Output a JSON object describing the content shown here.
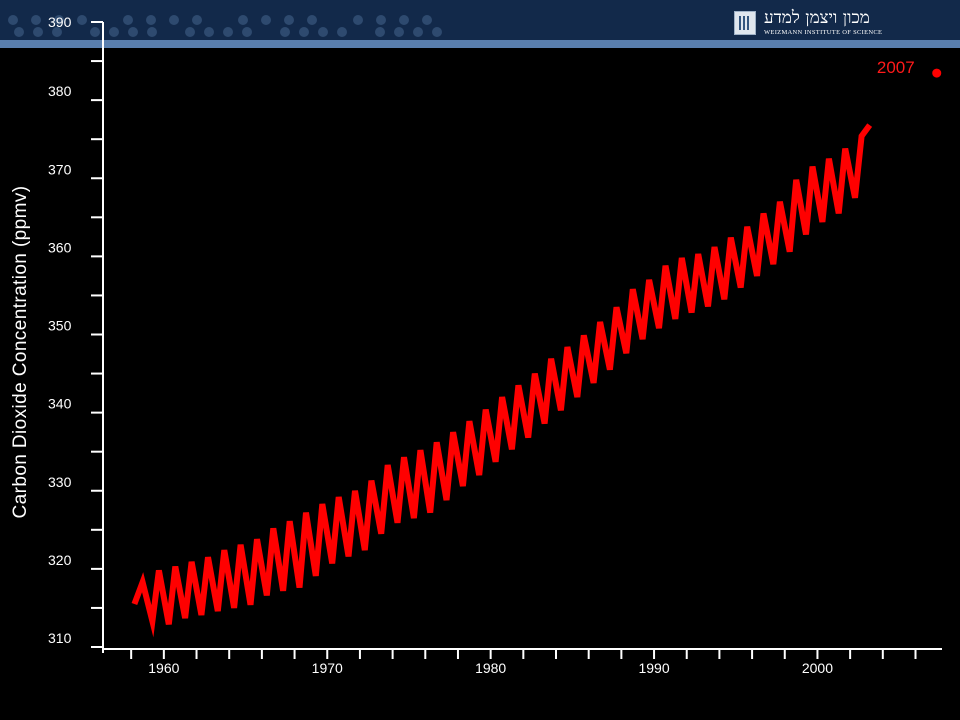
{
  "header": {
    "logo_hebrew": "מכון ויצמן למדע",
    "logo_english": "WEIZMANN INSTITUTE OF SCIENCE",
    "background_color": "#12294a",
    "stripe_color": "#5a7fae"
  },
  "chart_data": {
    "type": "line",
    "title": "",
    "xlabel": "",
    "ylabel": "Carbon Dioxide Concentration (ppmv)",
    "xlim": [
      1957.5,
      2007.5
    ],
    "ylim": [
      310,
      390
    ],
    "x_tick_values": [
      1960,
      1970,
      1980,
      1990,
      2000
    ],
    "x_tick_labels": [
      "1960",
      "1970",
      "1980",
      "1990",
      "2000"
    ],
    "y_tick_values": [
      310,
      320,
      330,
      340,
      350,
      360,
      370,
      380,
      390
    ],
    "y_tick_labels": [
      "310",
      "320",
      "330",
      "340",
      "350",
      "360",
      "370",
      "380",
      "390"
    ],
    "grid": false,
    "line_color": "#ff0000",
    "series": [
      {
        "x": [
          1958.2,
          1958.7,
          1959.3,
          1959.7,
          1960.3,
          1960.7,
          1961.3,
          1961.7,
          1962.3,
          1962.7,
          1963.3,
          1963.7,
          1964.3,
          1964.7,
          1965.3,
          1965.7,
          1966.3,
          1966.7,
          1967.3,
          1967.7,
          1968.3,
          1968.7,
          1969.3,
          1969.7,
          1970.3,
          1970.7,
          1971.3,
          1971.7,
          1972.3,
          1972.7,
          1973.3,
          1973.7,
          1974.3,
          1974.7,
          1975.3,
          1975.7,
          1976.3,
          1976.7,
          1977.3,
          1977.7,
          1978.3,
          1978.7,
          1979.3,
          1979.7,
          1980.3,
          1980.7,
          1981.3,
          1981.7,
          1982.3,
          1982.7,
          1983.3,
          1983.7,
          1984.3,
          1984.7,
          1985.3,
          1985.7,
          1986.3,
          1986.7,
          1987.3,
          1987.7,
          1988.3,
          1988.7,
          1989.3,
          1989.7,
          1990.3,
          1990.7,
          1991.3,
          1991.7,
          1992.3,
          1992.7,
          1993.3,
          1993.7,
          1994.3,
          1994.7,
          1995.3,
          1995.7,
          1996.3,
          1996.7,
          1997.3,
          1997.7,
          1998.3,
          1998.7,
          1999.3,
          1999.7,
          2000.3,
          2000.7,
          2001.3,
          2001.7,
          2002.3,
          2002.7,
          2003.2
        ],
        "y": [
          315.5,
          318.3,
          313.3,
          319.8,
          312.9,
          320.3,
          313.7,
          320.9,
          314.1,
          321.5,
          314.6,
          322.4,
          315.0,
          323.1,
          315.4,
          323.8,
          316.6,
          325.2,
          317.2,
          326.1,
          317.6,
          327.2,
          319.1,
          328.3,
          320.7,
          329.2,
          321.6,
          330.0,
          322.4,
          331.3,
          324.5,
          333.3,
          325.9,
          334.3,
          326.5,
          335.2,
          327.2,
          336.2,
          328.8,
          337.5,
          330.6,
          338.9,
          332.0,
          340.4,
          333.7,
          342.0,
          335.3,
          343.5,
          336.8,
          345.0,
          338.6,
          346.9,
          340.3,
          348.4,
          342.0,
          349.9,
          343.8,
          351.6,
          345.5,
          353.5,
          347.6,
          355.8,
          349.4,
          357.0,
          350.8,
          358.8,
          352.0,
          359.8,
          352.8,
          360.3,
          353.6,
          361.2,
          354.5,
          362.4,
          356.0,
          363.8,
          357.5,
          365.5,
          359.0,
          367.0,
          360.6,
          369.8,
          362.8,
          371.5,
          364.4,
          372.5,
          365.5,
          373.8,
          367.5,
          375.4,
          376.8
        ]
      }
    ],
    "annotation": {
      "label": "2007",
      "x": 2007.3,
      "y": 385
    }
  }
}
